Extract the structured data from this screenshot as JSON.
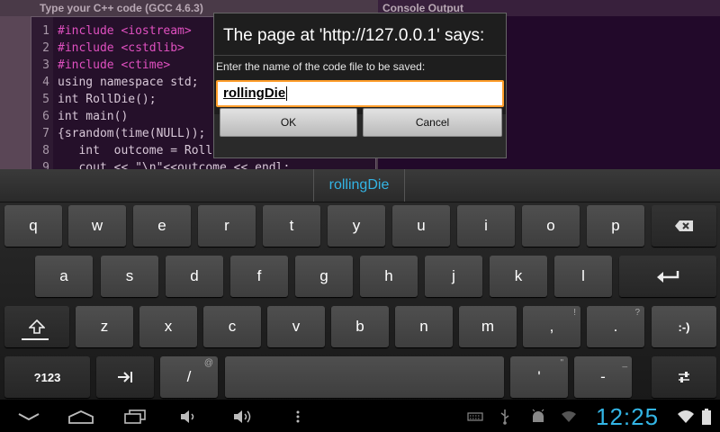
{
  "editor": {
    "title": "Type your C++ code (GCC 4.6.3)",
    "lines": [
      {
        "num": "1",
        "code": "#include <iostream>",
        "color": "#e050c0"
      },
      {
        "num": "2",
        "code": "#include <cstdlib>",
        "color": "#e050c0"
      },
      {
        "num": "3",
        "code": "#include <ctime>",
        "color": "#e050c0"
      },
      {
        "num": "4",
        "code": "using namespace std;",
        "color": "#d8c8d8"
      },
      {
        "num": "5",
        "code": "int RollDie();",
        "color": "#d8c8d8"
      },
      {
        "num": "6",
        "code": "int main()",
        "color": "#d8c8d8"
      },
      {
        "num": "7",
        "code": "{srandom(time(NULL));",
        "color": "#d8c8d8"
      },
      {
        "num": "8",
        "code": "   int  outcome = Roll",
        "color": "#d8c8d8"
      },
      {
        "num": "9",
        "code": "   cout << \"\\n\"<<outcome << endl;",
        "color": "#d8c8d8"
      }
    ]
  },
  "console": {
    "title": "Console Output"
  },
  "dialog": {
    "title": "The page at 'http://127.0.0.1' says:",
    "prompt": "Enter the name of the code file to be saved:",
    "input_value": "rollingDie",
    "ok_label": "OK",
    "cancel_label": "Cancel",
    "accent": "#ff9d2a"
  },
  "keyboard": {
    "suggestion": "rollingDie",
    "accent": "#33b5e5",
    "row1": [
      "q",
      "w",
      "e",
      "r",
      "t",
      "y",
      "u",
      "i",
      "o",
      "p"
    ],
    "row2": [
      "a",
      "s",
      "d",
      "f",
      "g",
      "h",
      "j",
      "k",
      "l"
    ],
    "row3": [
      "z",
      "x",
      "c",
      "v",
      "b",
      "n",
      "m"
    ],
    "comma": ",",
    "comma_hint": "!",
    "period": ".",
    "period_hint": "?",
    "smiley": ":-)",
    "symbols": "?123",
    "slash": "/",
    "slash_hint": "@",
    "apostrophe": "'",
    "apostrophe_hint": "\"",
    "dash": "-",
    "dash_hint": "_"
  },
  "status": {
    "time": "12:25"
  }
}
